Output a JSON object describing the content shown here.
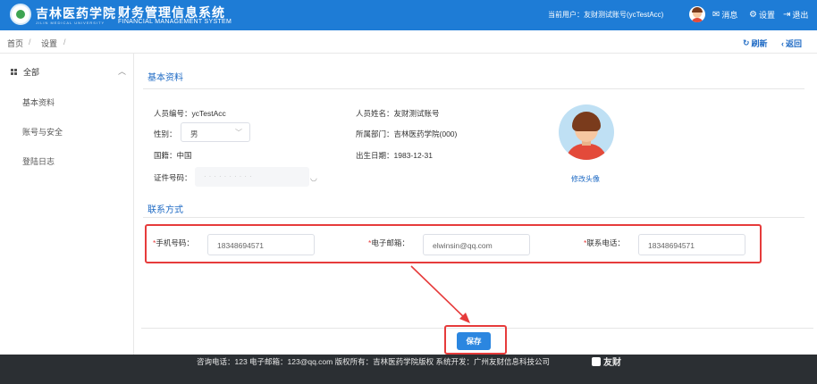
{
  "header": {
    "school_name": "吉林医药学院",
    "school_name_en": "JILIN MEDICAL UNIVERSITY",
    "system_title": "财务管理信息系统",
    "system_subtitle": "FINANCIAL MANAGEMENT SYSTEM",
    "current_user": "当前用户：友财测试账号(ycTestAcc)",
    "messages_label": "消息",
    "settings_label": "设置",
    "logout_label": "退出",
    "brand_color": "#1e7cd6"
  },
  "breadcrumb": {
    "items": [
      "首页",
      "设置"
    ],
    "refresh_label": "刷新",
    "back_label": "返回"
  },
  "sidebar": {
    "root_label": "全部",
    "items": [
      {
        "label": "基本资料"
      },
      {
        "label": "账号与安全"
      },
      {
        "label": "登陆日志"
      }
    ]
  },
  "profile": {
    "section_title": "基本资料",
    "staff_id_label": "人员编号：",
    "staff_id": "ycTestAcc",
    "gender_label": "性别：",
    "gender_value": "男",
    "nationality_label": "国籍：",
    "nationality": "中国",
    "id_number_label": "证件号码：",
    "id_number_masked": "··········",
    "name_label": "人员姓名：",
    "name": "友财测试账号",
    "department_label": "所属部门：",
    "department": "吉林医药学院(000)",
    "birth_label": "出生日期：",
    "birth_date": "1983-12-31",
    "change_avatar_label": "修改头像"
  },
  "contact": {
    "section_title": "联系方式",
    "mobile_label": "手机号码：",
    "mobile_value": "18348694571",
    "email_label": "电子邮箱：",
    "email_value": "elwinsin@qq.com",
    "phone_label": "联系电话：",
    "phone_value": "18348694571",
    "required_mark": "*",
    "highlight_color": "#e63b3b"
  },
  "actions": {
    "save_label": "保存"
  },
  "footer": {
    "text": "咨询电话：123   电子邮箱：123@qq.com   版权所有：吉林医药学院版权   系统开发：广州友财信息科技公司",
    "brand": "友财"
  }
}
